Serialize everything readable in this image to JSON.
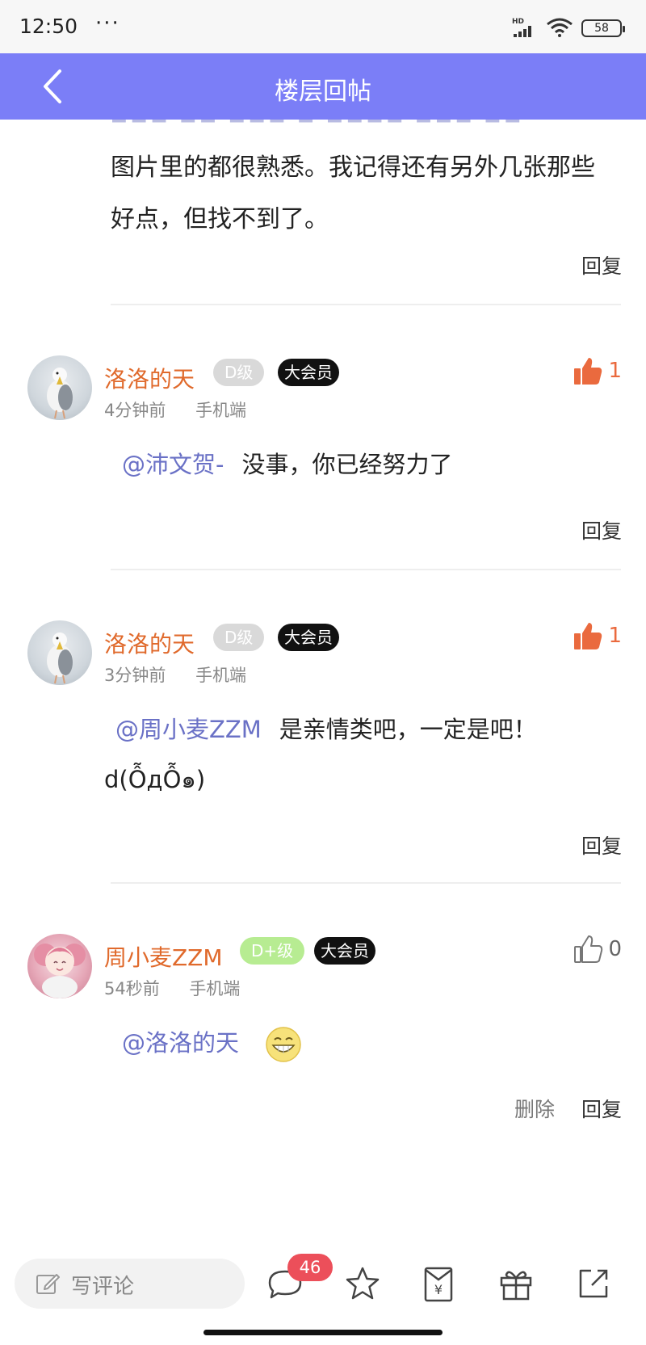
{
  "status_bar": {
    "time": "12:50",
    "more": "···",
    "network": "HD",
    "battery": "58"
  },
  "nav": {
    "title": "楼层回帖"
  },
  "previous_post": {
    "body": "图片里的都很熟悉。我记得还有另外几张那些好点，但找不到了。",
    "reply": "回复"
  },
  "posts": [
    {
      "author": "洛洛的天",
      "level": "D级",
      "vip": "大会员",
      "time": "4分钟前",
      "device": "手机端",
      "likes": "1",
      "mention": "@沛文贺-",
      "text": "没事，你已经努力了",
      "reply": "回复"
    },
    {
      "author": "洛洛的天",
      "level": "D级",
      "vip": "大会员",
      "time": "3分钟前",
      "device": "手机端",
      "likes": "1",
      "mention": "@周小麦ZZM",
      "text": "是亲情类吧，一定是吧！",
      "text2": "d(ỖдỖ๑)",
      "reply": "回复"
    },
    {
      "author": "周小麦ZZM",
      "level": "D+级",
      "vip": "大会员",
      "time": "54秒前",
      "device": "手机端",
      "likes": "0",
      "mention": "@洛洛的天",
      "delete": "删除",
      "reply": "回复"
    }
  ],
  "bottom_bar": {
    "placeholder": "写评论",
    "comment_count": "46"
  },
  "colors": {
    "nav": "#7b7ef7",
    "author": "#e06a2c",
    "mention": "#6a71c6",
    "like_active": "#ea6a3e",
    "badge": "#ec4f5a"
  }
}
